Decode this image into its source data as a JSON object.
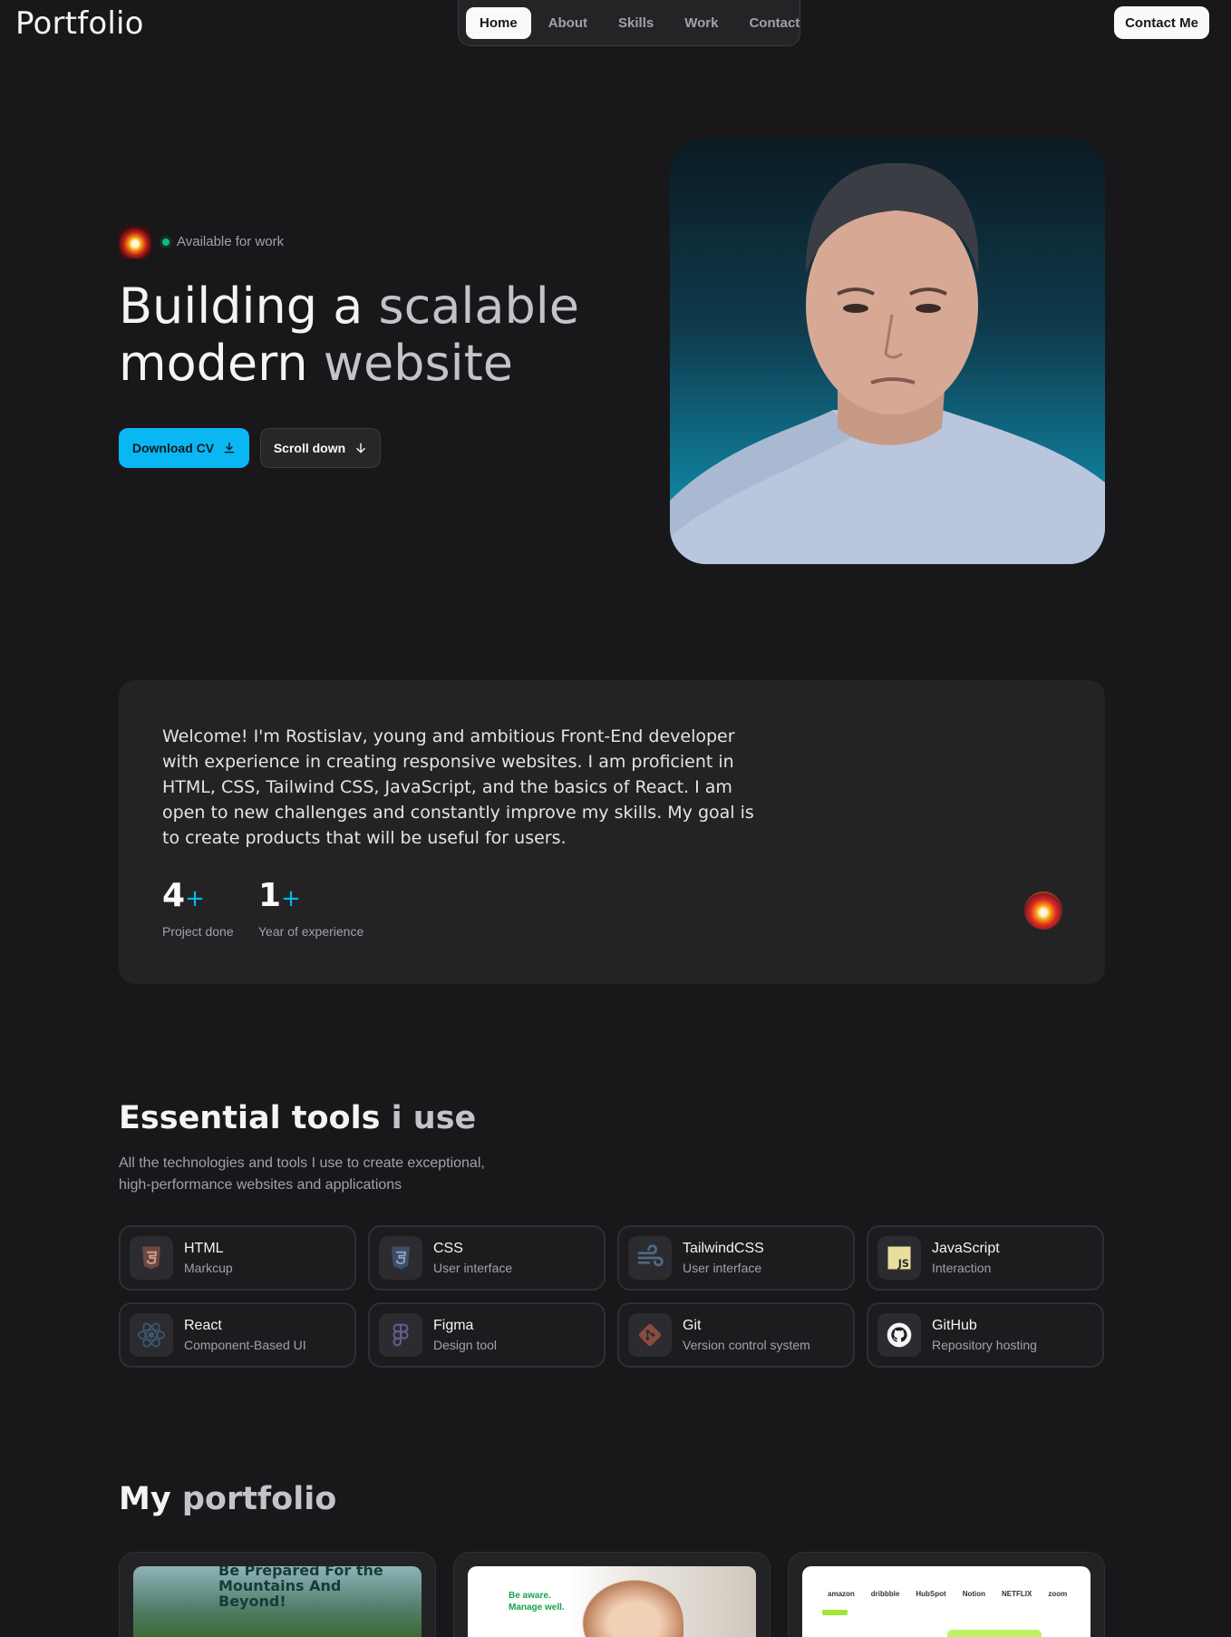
{
  "brand": {
    "logo": "Portfolio"
  },
  "nav": {
    "items": [
      {
        "label": "Home",
        "active": true
      },
      {
        "label": "About",
        "active": false
      },
      {
        "label": "Skills",
        "active": false
      },
      {
        "label": "Work",
        "active": false
      },
      {
        "label": "Contact",
        "active": false
      }
    ],
    "contact_button": "Contact Me"
  },
  "hero": {
    "availability": "Available for work",
    "headline_part1": "Building a",
    "headline_part2": "scalable",
    "headline_part3": "modern",
    "headline_part4": "website",
    "cta_primary": "Download CV",
    "cta_primary_icon": "download-icon",
    "cta_secondary": "Scroll down",
    "cta_secondary_icon": "arrow-down-icon",
    "accent_color": "#0ab7f2",
    "status_color": "#10b981"
  },
  "about": {
    "text": "Welcome! I'm Rostislav, young and ambitious Front-End developer with experience in creating responsive websites. I am proficient in HTML, CSS, Tailwind CSS, JavaScript, and the basics of React. I am open to new challenges and constantly improve my skills. My goal is to create products that will be useful for users.",
    "stats": [
      {
        "value": "4",
        "suffix": "+",
        "label": "Project done"
      },
      {
        "value": "1",
        "suffix": "+",
        "label": "Year of experience"
      }
    ]
  },
  "tools": {
    "title_part1": "Essential tools",
    "title_part2": "i use",
    "subtitle": "All the technologies and tools I use to create exceptional, high-performance websites and applications",
    "items": [
      {
        "name": "HTML",
        "desc": "Markcup",
        "icon": "html5-icon"
      },
      {
        "name": "CSS",
        "desc": "User interface",
        "icon": "css3-icon"
      },
      {
        "name": "TailwindCSS",
        "desc": "User interface",
        "icon": "tailwind-icon"
      },
      {
        "name": "JavaScript",
        "desc": "Interaction",
        "icon": "javascript-icon"
      },
      {
        "name": "React",
        "desc": "Component-Based UI",
        "icon": "react-icon"
      },
      {
        "name": "Figma",
        "desc": "Design tool",
        "icon": "figma-icon"
      },
      {
        "name": "Git",
        "desc": "Version control system",
        "icon": "git-icon"
      },
      {
        "name": "GitHub",
        "desc": "Repository hosting",
        "icon": "github-icon"
      }
    ]
  },
  "portfolio": {
    "title_part1": "My",
    "title_part2": "portfolio",
    "projects": [
      {
        "thumb_text": "Be Prepared For the Mountains And Beyond!"
      },
      {
        "thumb_text": "Be aware. Manage well."
      },
      {
        "logos": [
          "amazon",
          "dribbble",
          "HubSpot",
          "Notion",
          "NETFLIX",
          "zoom"
        ]
      }
    ]
  }
}
